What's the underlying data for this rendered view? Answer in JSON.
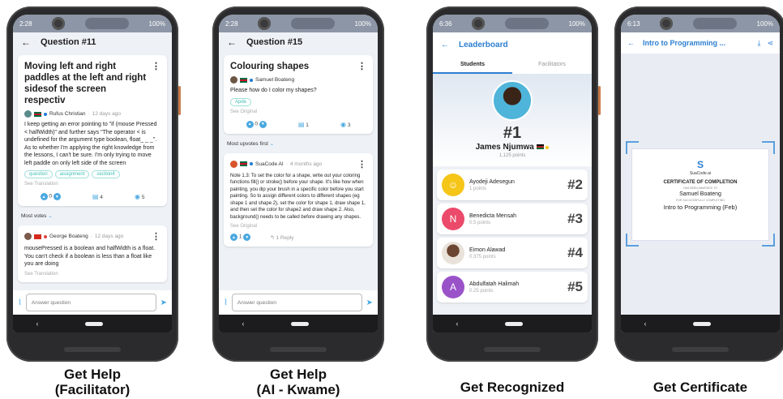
{
  "phones": {
    "facilitator": {
      "status_time": "2:28",
      "status_battery": "100%",
      "title": "Question #11",
      "question": {
        "title": "Moving left and right paddles at the left and right sidesof the screen respectiv",
        "author": "Rufus Christian",
        "time": "12 days ago",
        "body": "I keep  getting an error pointing to \"if (mouse Pressed < halfWidth)\" and further says \"The operator < is undefined for the argument type boolean, float_ _ _\". As to whether I'm applying the right knowledge from the lessons, I can't be sure.  I'm only trying to move left paddle on only left side of the screen",
        "tags": [
          "question",
          "assignment",
          "section4"
        ],
        "see_translation": "See Translation",
        "votes": "0",
        "comments": "4",
        "views": "5"
      },
      "sort_label": "Most votes",
      "answer": {
        "author": "George Boateng",
        "time": "12 days ago",
        "body": "mousePressed is a boolean and halfWidth is a float. You can't check if a boolean is less than a float like you are doing",
        "see_translation": "See Translation"
      },
      "input_placeholder": "Answer question"
    },
    "kwame": {
      "status_time": "2:28",
      "status_battery": "100%",
      "title": "Question #15",
      "question": {
        "title": "Colouring shapes",
        "author": "Samuel Boateng",
        "body": "Please how do I color my shapes?",
        "tag": "Apde",
        "see_original": "See Original",
        "votes": "0",
        "comments": "1",
        "views": "3"
      },
      "sort_label": "Most upvotes first",
      "answer": {
        "author": "SuaCode AI",
        "time": "4 months ago",
        "body": "Note 1.3: To set the color for a shape, write out your coloring functions fill() or stroke() before your shape. It's like how when painting, you dip your brush in a specific color before you start painting. So to assign different colors to different shapes (eg shape 1 and shape 2), set the color for shape 1, draw shape 1, and then set the color for shape2 and draw shape 2. Also, background() needs to be called before drawing any shapes.",
        "see_original": "See Original",
        "votes": "1",
        "reply": "1 Reply"
      },
      "input_placeholder": "Answer question"
    },
    "leaderboard": {
      "status_time": "6:36",
      "status_battery": "100%",
      "title": "Leaderboard",
      "tabs": [
        "Students",
        "Facilitators"
      ],
      "top": {
        "rank": "#1",
        "name": "James Njumwa",
        "points": "1,125 points"
      },
      "rows": [
        {
          "name": "Ayodeji Adesegun",
          "points": "1 points",
          "rank": "#2",
          "initial": "",
          "color": "#f5c518"
        },
        {
          "name": "Benedicta  Mensah",
          "points": "0.5 points",
          "rank": "#3",
          "initial": "N",
          "color": "#ec4a6a"
        },
        {
          "name": "Eimon Alawad",
          "points": "0.375 points",
          "rank": "#4",
          "initial": "",
          "color": "#8a6a50"
        },
        {
          "name": "Abdulfatah Halimah",
          "points": "0.25 points",
          "rank": "#5",
          "initial": "A",
          "color": "#9a52c8"
        }
      ]
    },
    "certificate": {
      "status_time": "6:13",
      "status_battery": "100%",
      "title": "Intro to Programming ...",
      "logo": "S",
      "brand": "SuaCode.ai",
      "heading": "CERTIFICATE OF COMPLETION",
      "awarded_label": "HAS BEEN AWARDED TO",
      "recipient": "Samuel Boateng",
      "completing_label": "FOR SUCCESSFULLY COMPLETING",
      "course": "Intro to Programming (Feb)"
    }
  },
  "captions": {
    "facilitator": [
      "Get Help",
      "(Facilitator)"
    ],
    "kwame": [
      "Get Help",
      "(AI - Kwame)"
    ],
    "leaderboard": "Get Recognized",
    "certificate": "Get Certificate"
  }
}
